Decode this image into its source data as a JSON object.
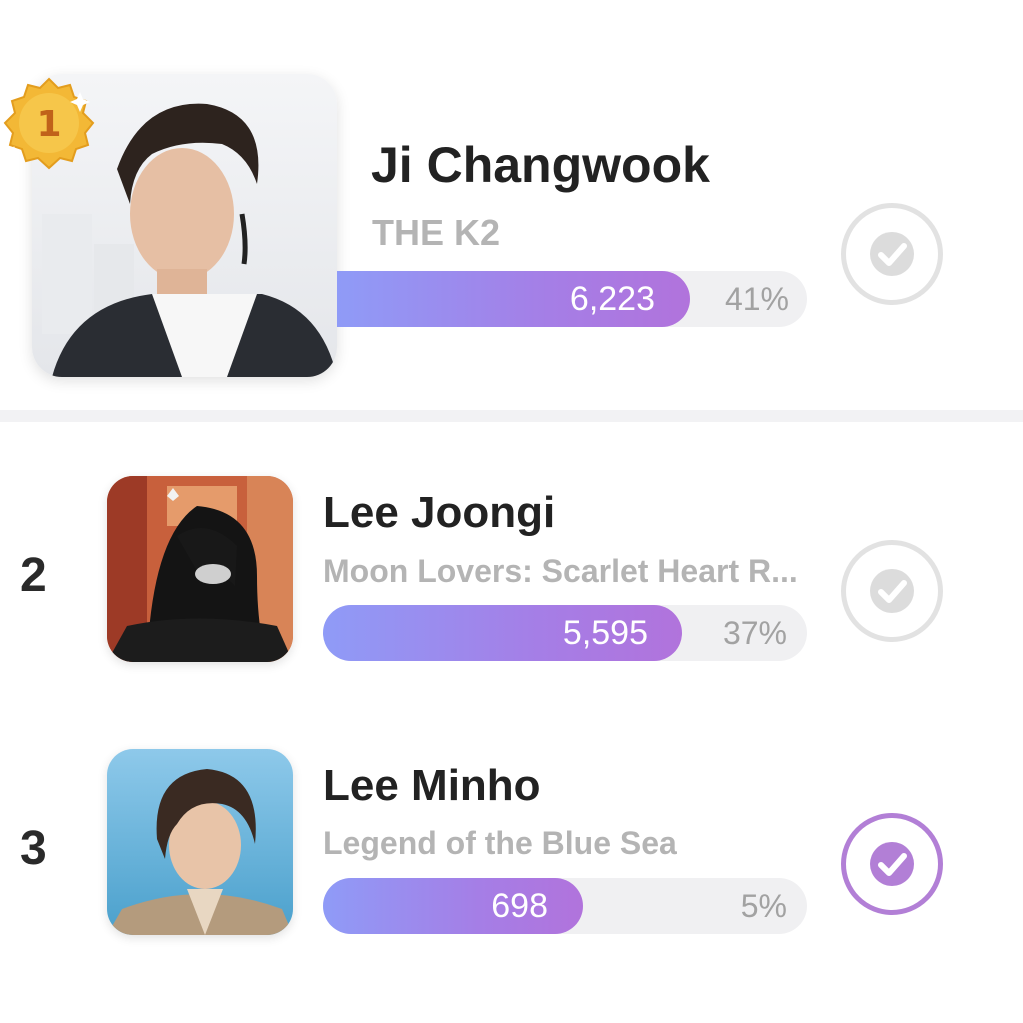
{
  "entries": [
    {
      "rank": "1",
      "medal_icon": "gold-medal-icon",
      "name": "Ji Changwook",
      "drama": "THE K2",
      "votes": "6,223",
      "percent": "41%",
      "share": 41,
      "selected": false
    },
    {
      "rank": "2",
      "name": "Lee Joongi",
      "drama": "Moon Lovers: Scarlet Heart R...",
      "votes": "5,595",
      "percent": "37%",
      "share": 37,
      "selected": false
    },
    {
      "rank": "3",
      "name": "Lee Minho",
      "drama": "Legend of the Blue Sea",
      "votes": "698",
      "percent": "5%",
      "share": 5,
      "selected": true
    }
  ],
  "colors": {
    "bar_start": "#8f9bf7",
    "bar_end": "#b173dc",
    "check_selected": "#b27fd6",
    "check_unselected": "#dcdcdc"
  }
}
